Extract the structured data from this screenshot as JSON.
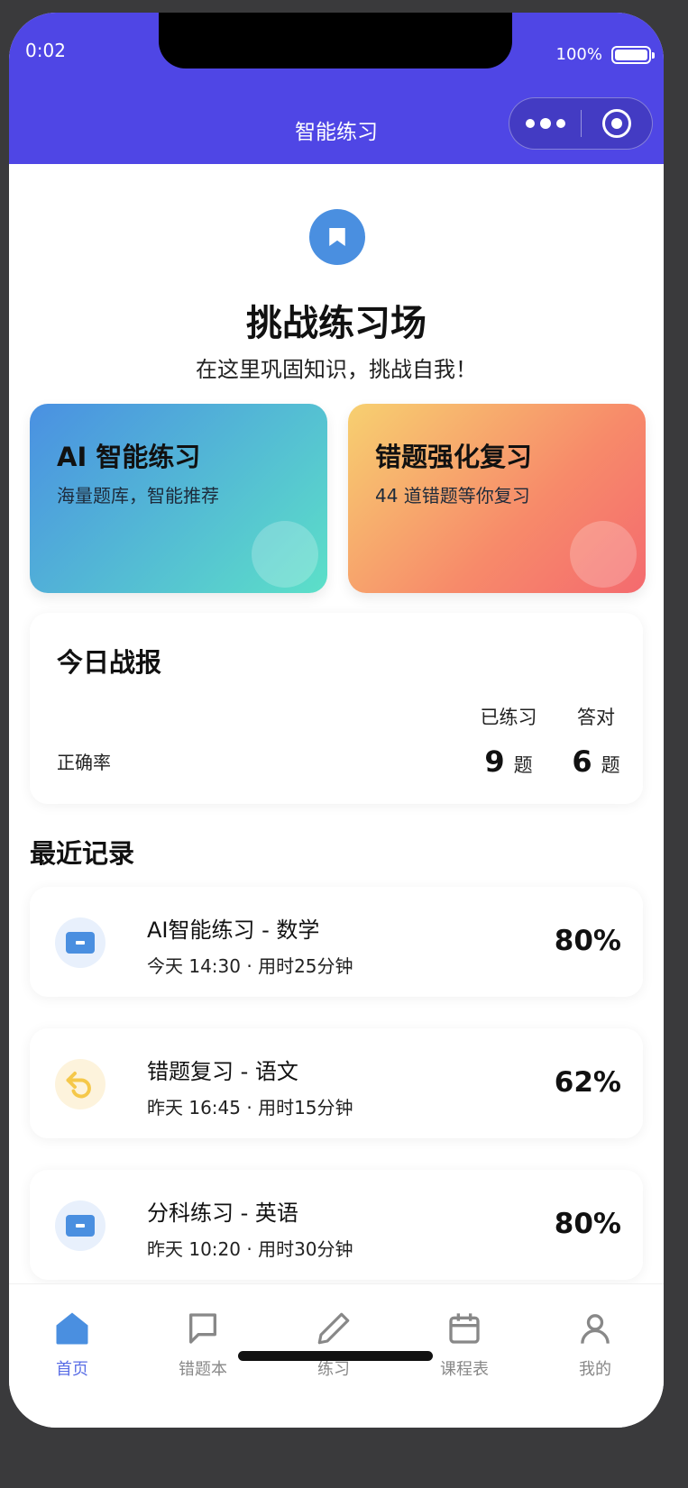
{
  "status_bar": {
    "time": "0:02",
    "battery": "100%"
  },
  "nav": {
    "title": "智能练习"
  },
  "hero": {
    "title": "挑战练习场",
    "subtitle": "在这里巩固知识，挑战自我！"
  },
  "features": [
    {
      "title": "AI 智能练习",
      "desc": "海量题库，智能推荐"
    },
    {
      "title": "错题强化复习",
      "desc": "44 道错题等你复习"
    }
  ],
  "report": {
    "title": "今日战报",
    "accuracy_label": "正确率",
    "practiced_label": "已练习",
    "practiced_value": "9",
    "correct_label": "答对",
    "correct_value": "6",
    "unit": "题"
  },
  "recent": {
    "title": "最近记录",
    "items": [
      {
        "title": "AI智能练习 - 数学",
        "meta": "今天 14:30 · 用时25分钟",
        "score": "80%",
        "icon": "ticket-icon"
      },
      {
        "title": "错题复习 - 语文",
        "meta": "昨天 16:45 · 用时15分钟",
        "score": "62%",
        "icon": "undo-icon"
      },
      {
        "title": "分科练习 - 英语",
        "meta": "昨天 10:20 · 用时30分钟",
        "score": "80%",
        "icon": "ticket-icon"
      }
    ]
  },
  "tabbar": [
    {
      "label": "首页",
      "icon": "home-icon",
      "active": true
    },
    {
      "label": "错题本",
      "icon": "message-square-icon",
      "active": false
    },
    {
      "label": "练习",
      "icon": "pencil-icon",
      "active": false
    },
    {
      "label": "课程表",
      "icon": "calendar-icon",
      "active": false
    },
    {
      "label": "我的",
      "icon": "user-icon",
      "active": false
    }
  ],
  "colors": {
    "brand": "#4f46e5",
    "tab_active": "#5a6ee6",
    "icon_blue": "#4a8fe0",
    "icon_yellow": "#f5c84a"
  }
}
